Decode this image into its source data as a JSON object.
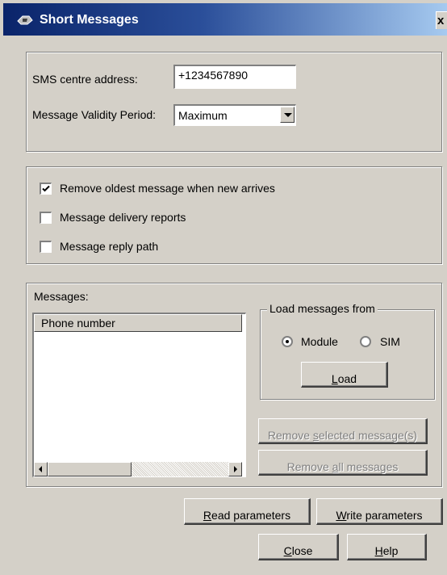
{
  "window": {
    "title": "Short Messages",
    "close_glyph": "x"
  },
  "sms_settings": {
    "centre_address_label": "SMS centre address:",
    "centre_address_value": "+1234567890",
    "validity_label": "Message Validity Period:",
    "validity_value": "Maximum"
  },
  "options": [
    {
      "label": "Remove oldest message when new arrives",
      "checked": true
    },
    {
      "label": "Message delivery reports",
      "checked": false
    },
    {
      "label": "Message reply path",
      "checked": false
    }
  ],
  "messages": {
    "label": "Messages:",
    "columns": [
      "Phone number"
    ],
    "rows": []
  },
  "load_from": {
    "legend": "Load messages from",
    "options": [
      {
        "label": "Module",
        "selected": true
      },
      {
        "label": "SIM",
        "selected": false
      }
    ],
    "load_button": {
      "pre": "",
      "u": "L",
      "post": "oad"
    }
  },
  "message_actions": {
    "remove_selected": {
      "pre": "Remove ",
      "u": "s",
      "post": "elected message(s)"
    },
    "remove_all": {
      "pre": "Remove ",
      "u": "a",
      "post": "ll messages"
    }
  },
  "bottom_buttons": {
    "read": {
      "pre": "",
      "u": "R",
      "post": "ead parameters"
    },
    "write": {
      "pre": "",
      "u": "W",
      "post": "rite parameters"
    },
    "close": {
      "pre": "",
      "u": "C",
      "post": "lose"
    },
    "help": {
      "pre": "",
      "u": "H",
      "post": "elp"
    }
  },
  "icons": {
    "title": "phone-icon",
    "check": "checkmark-icon",
    "combo_arrow": "chevron-down-icon",
    "scroll_left": "arrow-left-icon",
    "scroll_right": "arrow-right-icon"
  }
}
